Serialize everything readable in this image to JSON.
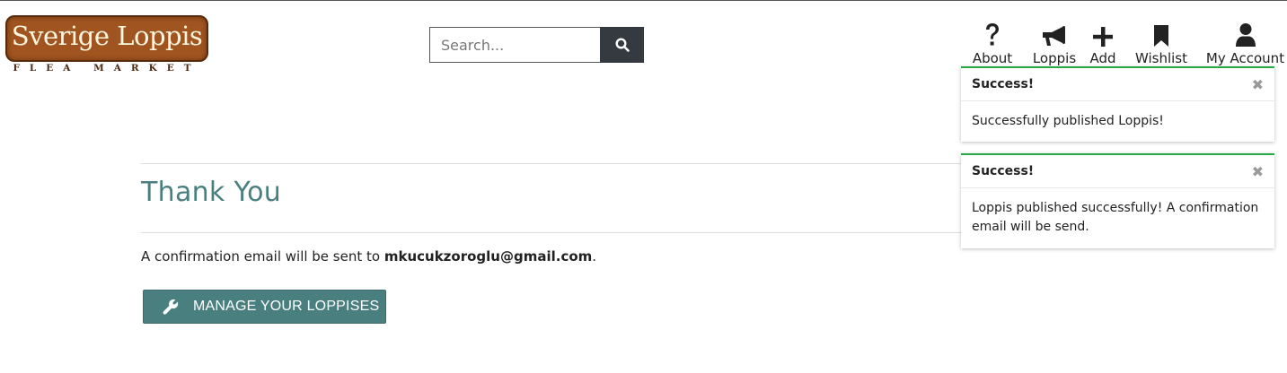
{
  "logo": {
    "title": "Sverige Loppis",
    "subtitle": "FLEA MARKET"
  },
  "search": {
    "placeholder": "Search...",
    "icon": "search-icon"
  },
  "nav": {
    "about": "About",
    "loppis": "Loppis",
    "add": "Add",
    "wishlist": "Wishlist",
    "account": "My Account"
  },
  "main": {
    "title": "Thank You",
    "message_prefix": "A confirmation email will be sent to ",
    "email": "mkucukzoroglu@gmail.com",
    "message_suffix": ".",
    "manage_button": "MANAGE YOUR LOPPISES"
  },
  "toasts": [
    {
      "title": "Success!",
      "body": "Successfully published Loppis!",
      "close": "✖"
    },
    {
      "title": "Success!",
      "body": "Loppis published successfully! A confirmation email will be send.",
      "close": "✖"
    }
  ],
  "colors": {
    "accent": "#4a7f80",
    "success": "#28a745",
    "dark": "#343a40",
    "logo_bg": "#a0541f"
  }
}
